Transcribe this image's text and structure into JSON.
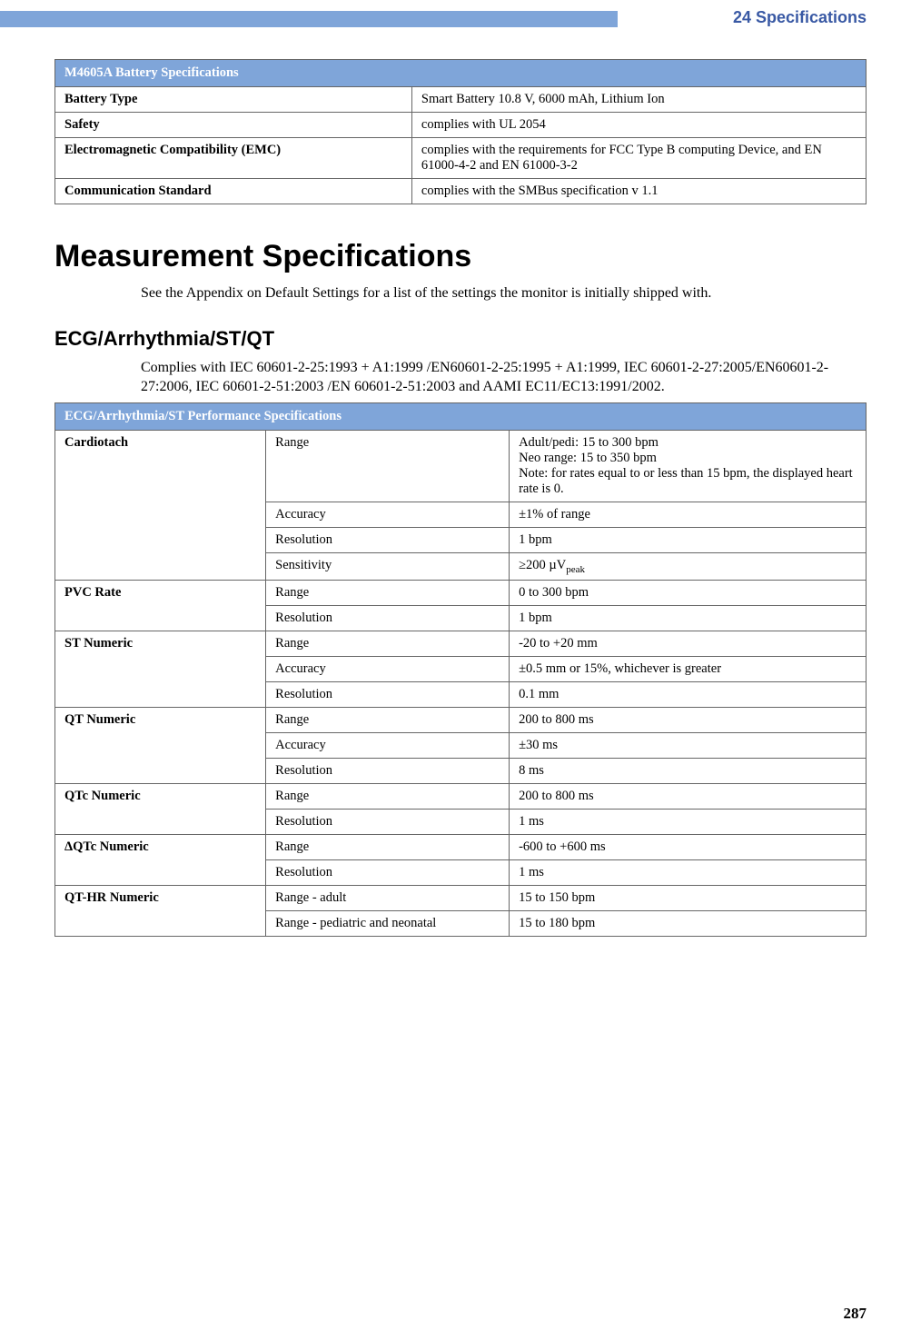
{
  "header": {
    "chapter": "24 Specifications",
    "pageNumber": "287"
  },
  "batteryTable": {
    "title": "M4605A Battery Specifications",
    "rows": [
      {
        "label": "Battery Type",
        "value": "Smart Battery 10.8 V, 6000 mAh, Lithium Ion"
      },
      {
        "label": "Safety",
        "value": "complies with UL 2054"
      },
      {
        "label": "Electromagnetic Compatibility (EMC)",
        "value": "complies with the requirements for FCC Type B computing Device, and EN 61000-4-2 and EN 61000-3-2"
      },
      {
        "label": "Communication Standard",
        "value": "complies with the SMBus specification v 1.1"
      }
    ]
  },
  "section": {
    "heading": "Measurement Specifications",
    "intro": "See the Appendix on Default Settings for a list of the settings the monitor is initially shipped with."
  },
  "subsection": {
    "heading": "ECG/Arrhythmia/ST/QT",
    "intro": "Complies with IEC 60601-2-25:1993 + A1:1999 /EN60601-2-25:1995 + A1:1999, IEC 60601-2-27:2005/EN60601-2-27:2006, IEC 60601-2-51:2003 /EN 60601-2-51:2003 and AAMI EC11/EC13:1991/2002."
  },
  "ecgTable": {
    "title": "ECG/Arrhythmia/ST Performance Specifications",
    "groups": [
      {
        "name": "Cardiotach",
        "rows": [
          {
            "param": "Range",
            "value": "Adult/pedi: 15 to 300 bpm\nNeo range: 15 to 350 bpm\nNote: for rates equal to or less than 15 bpm, the displayed heart rate is 0."
          },
          {
            "param": "Accuracy",
            "value": "±1% of range"
          },
          {
            "param": "Resolution",
            "value": "1 bpm"
          },
          {
            "param": "Sensitivity",
            "value": "≥200 µVpeak",
            "subscript": "peak",
            "prefix": "≥200 µV"
          }
        ]
      },
      {
        "name": "PVC Rate",
        "rows": [
          {
            "param": "Range",
            "value": "0 to 300 bpm"
          },
          {
            "param": "Resolution",
            "value": "1 bpm"
          }
        ]
      },
      {
        "name": "ST Numeric",
        "rows": [
          {
            "param": "Range",
            "value": "-20 to +20 mm"
          },
          {
            "param": "Accuracy",
            "value": "±0.5 mm or 15%, whichever is greater"
          },
          {
            "param": "Resolution",
            "value": "0.1 mm"
          }
        ]
      },
      {
        "name": "QT Numeric",
        "rows": [
          {
            "param": "Range",
            "value": "200 to 800 ms"
          },
          {
            "param": "Accuracy",
            "value": "±30 ms"
          },
          {
            "param": "Resolution",
            "value": "8 ms"
          }
        ]
      },
      {
        "name": "QTc Numeric",
        "rows": [
          {
            "param": "Range",
            "value": "200 to 800 ms"
          },
          {
            "param": "Resolution",
            "value": "1 ms"
          }
        ]
      },
      {
        "name": "ΔQTc Numeric",
        "rows": [
          {
            "param": "Range",
            "value": "-600 to +600 ms"
          },
          {
            "param": "Resolution",
            "value": "1 ms"
          }
        ]
      },
      {
        "name": "QT-HR Numeric",
        "rows": [
          {
            "param": "Range - adult",
            "value": "15 to 150 bpm"
          },
          {
            "param": "Range - pediatric and neonatal",
            "value": "15 to 180 bpm"
          }
        ]
      }
    ]
  }
}
